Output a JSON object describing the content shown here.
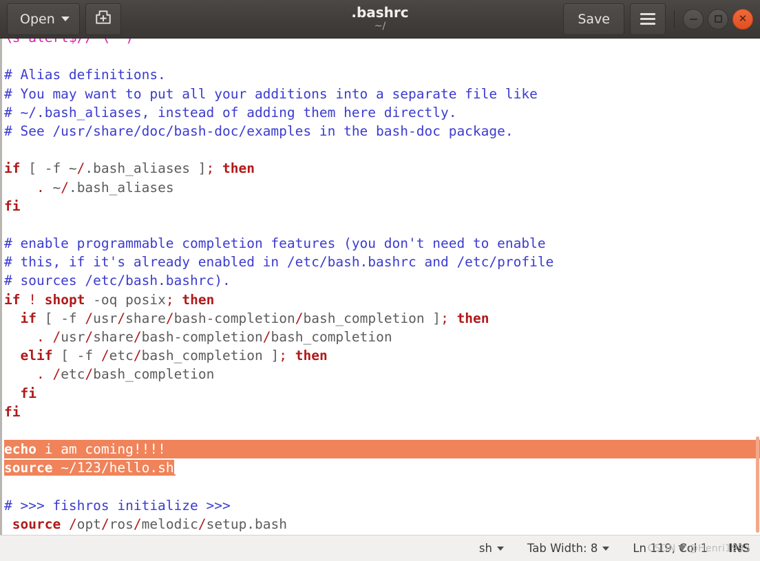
{
  "window": {
    "title": ".bashrc",
    "subtitle": "~/"
  },
  "headerbar": {
    "open_label": "Open",
    "open_icon": "chevron-down-icon",
    "new_doc_icon": "new-document-icon",
    "save_label": "Save",
    "menu_icon": "hamburger-menu-icon",
    "minimize_icon": "minimize-icon",
    "maximize_icon": "maximize-icon",
    "close_icon": "close-icon",
    "close_glyph": "✕"
  },
  "editor": {
    "lines": [
      {
        "id": 0,
        "type": "clipped",
        "segments": [
          {
            "t": "\\s*alert$//'\\'')\"'",
            "c": "str"
          }
        ]
      },
      {
        "id": 1,
        "type": "blank",
        "segments": []
      },
      {
        "id": 2,
        "type": "code",
        "segments": [
          {
            "t": "# Alias definitions.",
            "c": "cmt"
          }
        ]
      },
      {
        "id": 3,
        "type": "code",
        "segments": [
          {
            "t": "# You may want to put all your additions into a separate file like",
            "c": "cmt"
          }
        ]
      },
      {
        "id": 4,
        "type": "code",
        "segments": [
          {
            "t": "# ~/.bash_aliases, instead of adding them here directly.",
            "c": "cmt"
          }
        ]
      },
      {
        "id": 5,
        "type": "code",
        "segments": [
          {
            "t": "# See /usr/share/doc/bash-doc/examples in the bash-doc package.",
            "c": "cmt"
          }
        ]
      },
      {
        "id": 6,
        "type": "blank",
        "segments": []
      },
      {
        "id": 7,
        "type": "code",
        "segments": [
          {
            "t": "if",
            "c": "kw"
          },
          {
            "t": " [ -f ~",
            "c": "plain"
          },
          {
            "t": "/",
            "c": "pun"
          },
          {
            "t": ".bash_aliases ]",
            "c": "plain"
          },
          {
            "t": ";",
            "c": "pun"
          },
          {
            "t": " ",
            "c": "plain"
          },
          {
            "t": "then",
            "c": "kw"
          }
        ]
      },
      {
        "id": 8,
        "type": "code",
        "segments": [
          {
            "t": "    ",
            "c": "plain"
          },
          {
            "t": ".",
            "c": "pun"
          },
          {
            "t": " ~",
            "c": "plain"
          },
          {
            "t": "/",
            "c": "pun"
          },
          {
            "t": ".bash_aliases",
            "c": "plain"
          }
        ]
      },
      {
        "id": 9,
        "type": "code",
        "segments": [
          {
            "t": "fi",
            "c": "kw"
          }
        ]
      },
      {
        "id": 10,
        "type": "blank",
        "segments": []
      },
      {
        "id": 11,
        "type": "code",
        "segments": [
          {
            "t": "# enable programmable completion features (you don't need to enable",
            "c": "cmt"
          }
        ]
      },
      {
        "id": 12,
        "type": "code",
        "segments": [
          {
            "t": "# this, if it's already enabled in /etc/bash.bashrc and /etc/profile",
            "c": "cmt"
          }
        ]
      },
      {
        "id": 13,
        "type": "code",
        "segments": [
          {
            "t": "# sources /etc/bash.bashrc).",
            "c": "cmt"
          }
        ]
      },
      {
        "id": 14,
        "type": "code",
        "segments": [
          {
            "t": "if",
            "c": "kw"
          },
          {
            "t": " ",
            "c": "plain"
          },
          {
            "t": "!",
            "c": "pun"
          },
          {
            "t": " ",
            "c": "plain"
          },
          {
            "t": "shopt",
            "c": "kw"
          },
          {
            "t": " -oq posix",
            "c": "plain"
          },
          {
            "t": ";",
            "c": "pun"
          },
          {
            "t": " ",
            "c": "plain"
          },
          {
            "t": "then",
            "c": "kw"
          }
        ]
      },
      {
        "id": 15,
        "type": "code",
        "segments": [
          {
            "t": "  ",
            "c": "plain"
          },
          {
            "t": "if",
            "c": "kw"
          },
          {
            "t": " [ -f ",
            "c": "plain"
          },
          {
            "t": "/",
            "c": "pun"
          },
          {
            "t": "usr",
            "c": "plain"
          },
          {
            "t": "/",
            "c": "pun"
          },
          {
            "t": "share",
            "c": "plain"
          },
          {
            "t": "/",
            "c": "pun"
          },
          {
            "t": "bash-completion",
            "c": "plain"
          },
          {
            "t": "/",
            "c": "pun"
          },
          {
            "t": "bash_completion ]",
            "c": "plain"
          },
          {
            "t": ";",
            "c": "pun"
          },
          {
            "t": " ",
            "c": "plain"
          },
          {
            "t": "then",
            "c": "kw"
          }
        ]
      },
      {
        "id": 16,
        "type": "code",
        "segments": [
          {
            "t": "    ",
            "c": "plain"
          },
          {
            "t": ".",
            "c": "pun"
          },
          {
            "t": " ",
            "c": "plain"
          },
          {
            "t": "/",
            "c": "pun"
          },
          {
            "t": "usr",
            "c": "plain"
          },
          {
            "t": "/",
            "c": "pun"
          },
          {
            "t": "share",
            "c": "plain"
          },
          {
            "t": "/",
            "c": "pun"
          },
          {
            "t": "bash-completion",
            "c": "plain"
          },
          {
            "t": "/",
            "c": "pun"
          },
          {
            "t": "bash_completion",
            "c": "plain"
          }
        ]
      },
      {
        "id": 17,
        "type": "code",
        "segments": [
          {
            "t": "  ",
            "c": "plain"
          },
          {
            "t": "elif",
            "c": "kw"
          },
          {
            "t": " [ -f ",
            "c": "plain"
          },
          {
            "t": "/",
            "c": "pun"
          },
          {
            "t": "etc",
            "c": "plain"
          },
          {
            "t": "/",
            "c": "pun"
          },
          {
            "t": "bash_completion ]",
            "c": "plain"
          },
          {
            "t": ";",
            "c": "pun"
          },
          {
            "t": " ",
            "c": "plain"
          },
          {
            "t": "then",
            "c": "kw"
          }
        ]
      },
      {
        "id": 18,
        "type": "code",
        "segments": [
          {
            "t": "    ",
            "c": "plain"
          },
          {
            "t": ".",
            "c": "pun"
          },
          {
            "t": " ",
            "c": "plain"
          },
          {
            "t": "/",
            "c": "pun"
          },
          {
            "t": "etc",
            "c": "plain"
          },
          {
            "t": "/",
            "c": "pun"
          },
          {
            "t": "bash_completion",
            "c": "plain"
          }
        ]
      },
      {
        "id": 19,
        "type": "code",
        "segments": [
          {
            "t": "  ",
            "c": "plain"
          },
          {
            "t": "fi",
            "c": "kw"
          }
        ]
      },
      {
        "id": 20,
        "type": "code",
        "segments": [
          {
            "t": "fi",
            "c": "kw"
          }
        ]
      },
      {
        "id": 21,
        "type": "blank",
        "segments": []
      },
      {
        "id": 22,
        "type": "selected-full",
        "segments": [
          {
            "t": "echo",
            "c": "kw"
          },
          {
            "t": " i am coming",
            "c": "plain"
          },
          {
            "t": "!!!!",
            "c": "pun"
          }
        ]
      },
      {
        "id": 23,
        "type": "selected-partial",
        "segments": [
          {
            "t": "source",
            "c": "kw"
          },
          {
            "t": " ~",
            "c": "plain"
          },
          {
            "t": "/",
            "c": "pun"
          },
          {
            "t": "123",
            "c": "plain"
          },
          {
            "t": "/",
            "c": "pun"
          },
          {
            "t": "hello.sh",
            "c": "plain"
          }
        ]
      },
      {
        "id": 24,
        "type": "blank",
        "segments": []
      },
      {
        "id": 25,
        "type": "code",
        "segments": [
          {
            "t": "# >>> fishros initialize >>>",
            "c": "cmt"
          }
        ]
      },
      {
        "id": 26,
        "type": "code",
        "segments": [
          {
            "t": " ",
            "c": "plain"
          },
          {
            "t": "source",
            "c": "kw"
          },
          {
            "t": " ",
            "c": "plain"
          },
          {
            "t": "/",
            "c": "pun"
          },
          {
            "t": "opt",
            "c": "plain"
          },
          {
            "t": "/",
            "c": "pun"
          },
          {
            "t": "ros",
            "c": "plain"
          },
          {
            "t": "/",
            "c": "pun"
          },
          {
            "t": "melodic",
            "c": "plain"
          },
          {
            "t": "/",
            "c": "pun"
          },
          {
            "t": "setup.bash",
            "c": "plain"
          }
        ]
      }
    ],
    "colors": {
      "comment": "#3b3bd0",
      "keyword": "#b01919",
      "punctuation": "#b01919",
      "string": "#e020b0",
      "plain": "#5c5c5c",
      "selection": "#f0835a",
      "selection_text": "#ffffff",
      "background": "#ffffff"
    },
    "scrollbar": {
      "name": "vertical-scrollbar",
      "color": "#f4a88a"
    }
  },
  "statusbar": {
    "language": "sh",
    "language_caret": "chevron-down-icon",
    "tab_width": "Tab Width: 8",
    "tab_width_caret": "chevron-down-icon",
    "position": "Ln 119, Col 1",
    "insert_mode": "INS",
    "watermark_left": "CSDN",
    "watermark_right": "@Henri1993"
  }
}
